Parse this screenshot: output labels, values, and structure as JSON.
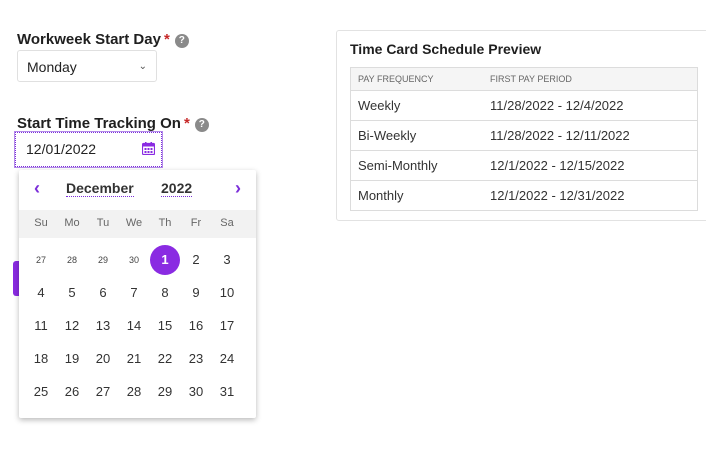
{
  "workweek": {
    "label": "Workweek Start Day",
    "required_mark": "*",
    "help_glyph": "?",
    "value": "Monday"
  },
  "tracking": {
    "label": "Start Time Tracking On",
    "required_mark": "*",
    "help_glyph": "?",
    "value": "12/01/2022"
  },
  "calendar": {
    "month": "December",
    "year": "2022",
    "prev_glyph": "‹",
    "next_glyph": "›",
    "weekdays": [
      "Su",
      "Mo",
      "Tu",
      "We",
      "Th",
      "Fr",
      "Sa"
    ],
    "weeks": [
      [
        "27",
        "28",
        "29",
        "30",
        "1",
        "2",
        "3"
      ],
      [
        "4",
        "5",
        "6",
        "7",
        "8",
        "9",
        "10"
      ],
      [
        "11",
        "12",
        "13",
        "14",
        "15",
        "16",
        "17"
      ],
      [
        "18",
        "19",
        "20",
        "21",
        "22",
        "23",
        "24"
      ],
      [
        "25",
        "26",
        "27",
        "28",
        "29",
        "30",
        "31"
      ]
    ],
    "selected_day": "1",
    "accent_color": "#8a2be2"
  },
  "preview": {
    "title": "Time Card Schedule Preview",
    "headers": [
      "PAY FREQUENCY",
      "FIRST PAY PERIOD"
    ],
    "rows": [
      [
        "Weekly",
        "11/28/2022 - 12/4/2022"
      ],
      [
        "Bi-Weekly",
        "11/28/2022 - 12/11/2022"
      ],
      [
        "Semi-Monthly",
        "12/1/2022 - 12/15/2022"
      ],
      [
        "Monthly",
        "12/1/2022 - 12/31/2022"
      ]
    ]
  }
}
